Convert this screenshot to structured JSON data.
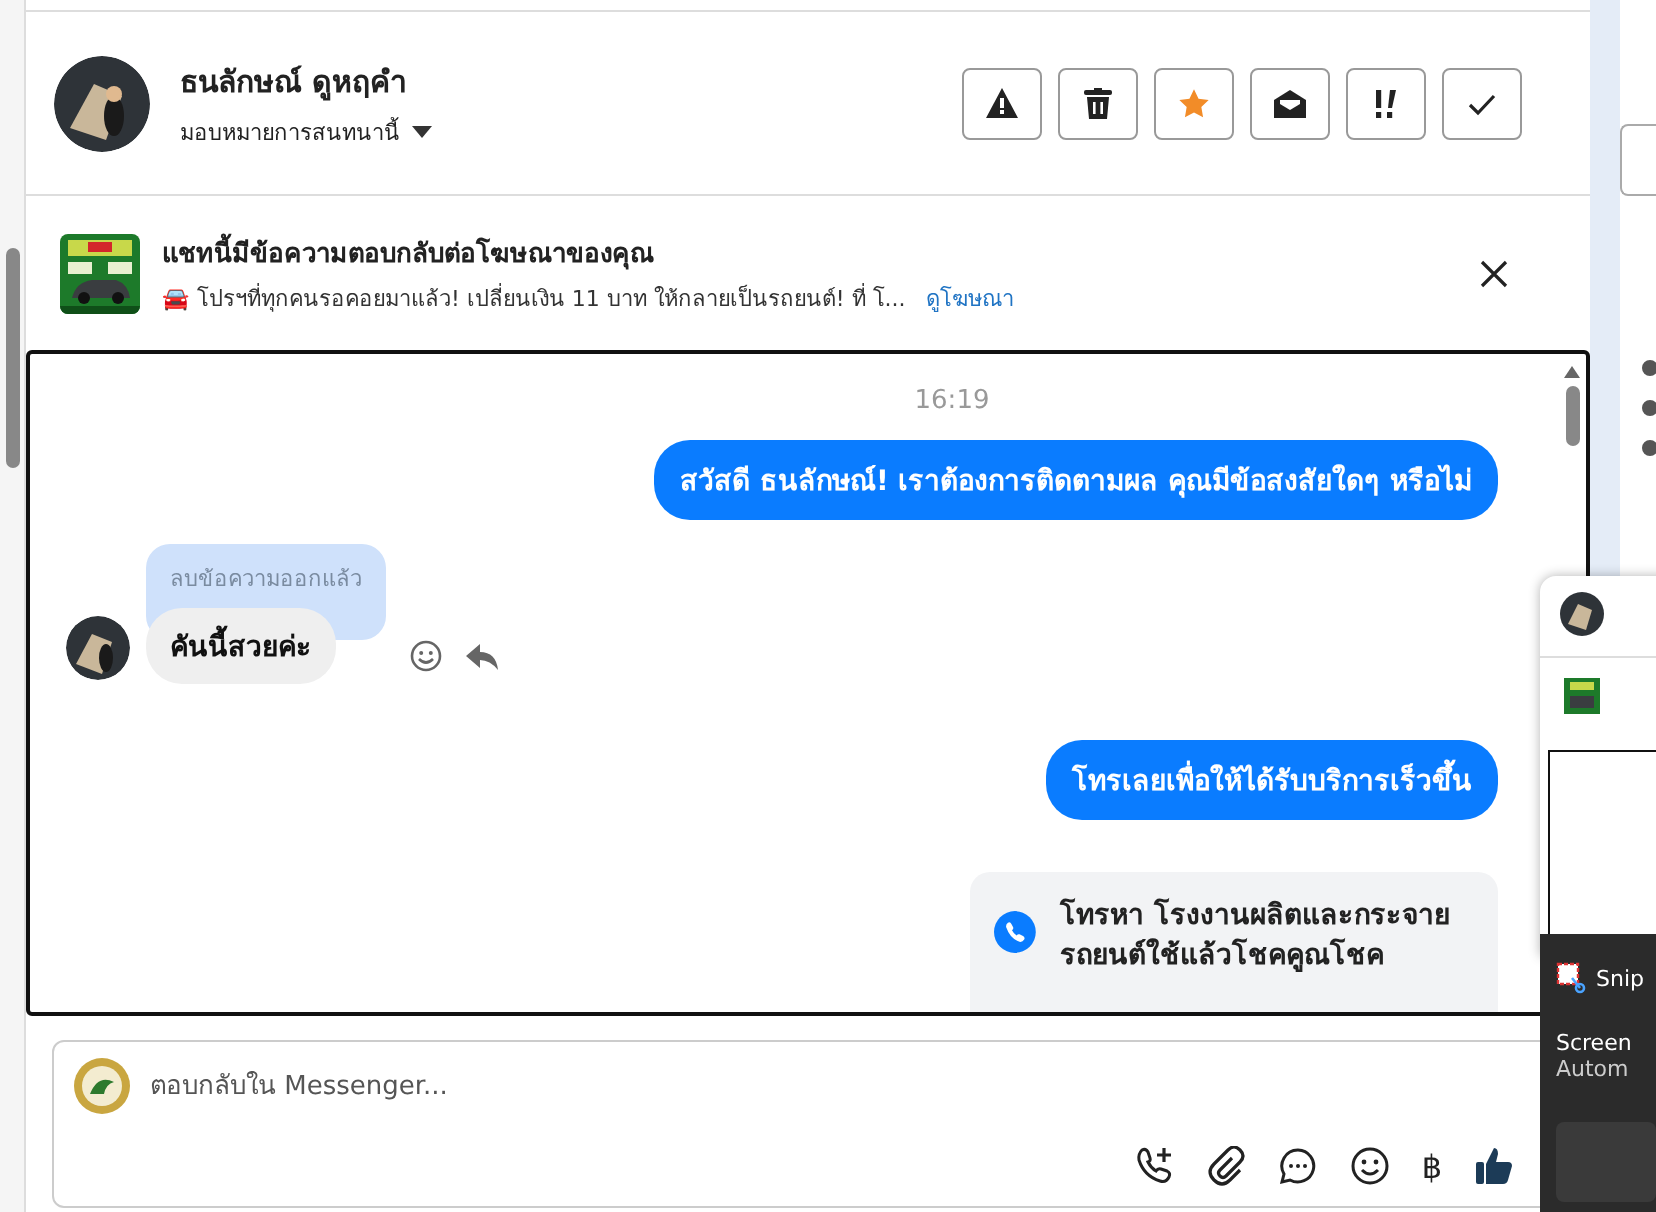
{
  "contact": {
    "name": "ธนลักษณ์ ดูหฤคำ",
    "assign_label": "มอบหมายการสนทนานี้"
  },
  "actions": [
    {
      "kind": "warning"
    },
    {
      "kind": "trash"
    },
    {
      "kind": "star"
    },
    {
      "kind": "envelope"
    },
    {
      "kind": "priority"
    },
    {
      "kind": "check"
    }
  ],
  "ad_banner": {
    "title": "แชทนี้มีข้อความตอบกลับต่อโฆษณาของคุณ",
    "snippet": "🚘 โปรฯที่ทุกคนรอคอยมาแล้ว! เปลี่ยนเงิน 11 บาท ให้กลายเป็นรถยนต์! ที่ โ...",
    "link": "ดูโฆษณา"
  },
  "messages": [
    {
      "kind": "time",
      "text": "16:19"
    },
    {
      "kind": "outgoing",
      "text": "สวัสดี ธนลักษณ์! เราต้องการติดตามผล คุณมีข้อสงสัยใดๆ หรือไม่"
    },
    {
      "kind": "incoming",
      "reply_note": "ลบข้อความออกแล้ว",
      "text": "คันนี้สวยค่ะ"
    },
    {
      "kind": "outgoing",
      "text": "โทรเลยเพื่อให้ได้รับบริการเร็วขึ้น"
    },
    {
      "kind": "call_card",
      "text": "โทรหา โรงงานผลิตและกระจายรถยนต์ใช้แล้วโชคคูณโชค"
    }
  ],
  "composer": {
    "placeholder": "ตอบกลับใน Messenger...",
    "tools": [
      {
        "kind": "call"
      },
      {
        "kind": "attach"
      },
      {
        "kind": "chat"
      },
      {
        "kind": "emoji"
      },
      {
        "kind": "text",
        "text": "฿"
      },
      {
        "kind": "like"
      }
    ]
  },
  "notification": {
    "app": "Snip",
    "title": "Screen",
    "body": "Autom"
  }
}
